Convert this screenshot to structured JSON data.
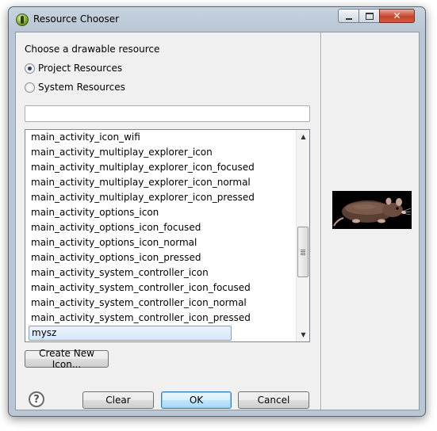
{
  "window": {
    "title": "Resource Chooser",
    "close_glyph": "✕"
  },
  "heading": "Choose a drawable resource",
  "radios": {
    "project": {
      "label": "Project Resources",
      "checked": true
    },
    "system": {
      "label": "System Resources",
      "checked": false
    }
  },
  "filter": {
    "value": ""
  },
  "list": {
    "items": [
      "main_activity_icon_wifi",
      "main_activity_multiplay_explorer_icon",
      "main_activity_multiplay_explorer_icon_focused",
      "main_activity_multiplay_explorer_icon_normal",
      "main_activity_multiplay_explorer_icon_pressed",
      "main_activity_options_icon",
      "main_activity_options_icon_focused",
      "main_activity_options_icon_normal",
      "main_activity_options_icon_pressed",
      "main_activity_system_controller_icon",
      "main_activity_system_controller_icon_focused",
      "main_activity_system_controller_icon_normal",
      "main_activity_system_controller_icon_pressed",
      "mysz"
    ],
    "selected": "mysz",
    "scroll_up_glyph": "▲",
    "scroll_down_glyph": "▼"
  },
  "buttons": {
    "create_new_icon": "Create New Icon...",
    "clear": "Clear",
    "ok": "OK",
    "cancel": "Cancel"
  },
  "help": {
    "glyph": "?"
  },
  "preview": {
    "icon": "rat-image"
  }
}
